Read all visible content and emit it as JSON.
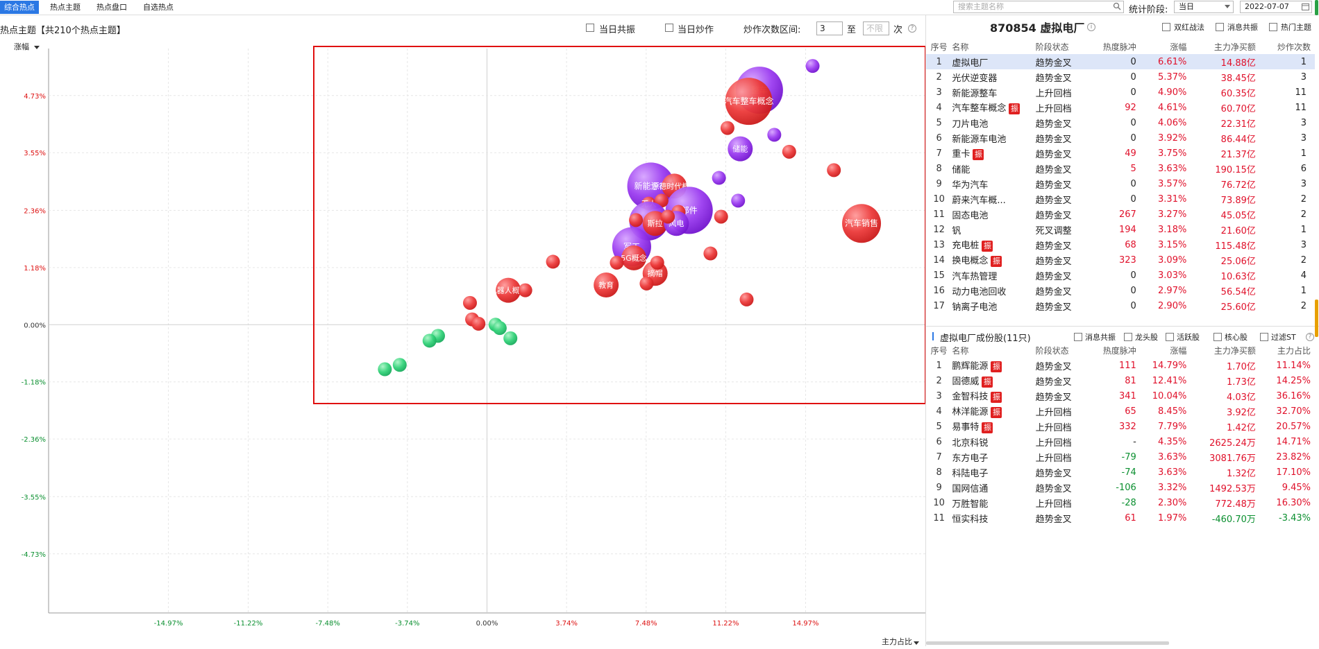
{
  "top_tabs": [
    "综合热点",
    "热点主题",
    "热点盘口",
    "自选热点"
  ],
  "search": {
    "placeholder": "搜索主题名称"
  },
  "stage_label": "统计阶段:",
  "stage_value": "当日",
  "date_value": "2022-07-07",
  "chart_header": {
    "title": "热点主题【共210个热点主题】",
    "cb_same_day_resonance": "当日共振",
    "cb_same_day_hype": "当日炒作",
    "hype_range_label": "炒作次数区间:",
    "hype_min": "3",
    "to": "至",
    "hype_max_placeholder": "不限",
    "times": "次"
  },
  "chart_data": {
    "type": "scatter",
    "ylabel": "涨幅",
    "xlabel": "主力占比",
    "xlim": [
      -20.6,
      20.6
    ],
    "ylim": [
      -5.95,
      5.7
    ],
    "x_ticks": [
      "-14.97%",
      "-11.22%",
      "-7.48%",
      "-3.74%",
      "0.00%",
      "3.74%",
      "7.48%",
      "11.22%",
      "14.97%"
    ],
    "x_tick_values": [
      -14.97,
      -11.22,
      -7.48,
      -3.74,
      0.0,
      3.74,
      7.48,
      11.22,
      14.97
    ],
    "y_ticks": [
      "4.73%",
      "3.55%",
      "2.36%",
      "1.18%",
      "0.00%",
      "-1.18%",
      "-2.36%",
      "-3.55%",
      "-4.73%"
    ],
    "y_tick_values": [
      4.73,
      3.55,
      2.36,
      1.18,
      0.0,
      -1.18,
      -2.36,
      -3.55,
      -4.73
    ],
    "colors": {
      "red": "#e8343a",
      "purple": "#9333ea",
      "green": "#2ecc71",
      "tick_red": "#d11",
      "tick_green": "#0a8f2f"
    },
    "points": [
      {
        "x": 12.8,
        "y": 4.84,
        "size": "xl",
        "color": "purple",
        "label": "整车"
      },
      {
        "x": 12.3,
        "y": 4.61,
        "size": "xl",
        "color": "red",
        "label": "汽车整车概念"
      },
      {
        "x": 15.3,
        "y": 5.34,
        "size": "s",
        "color": "purple",
        "label": ""
      },
      {
        "x": 11.3,
        "y": 4.06,
        "size": "s",
        "color": "red",
        "label": ""
      },
      {
        "x": 13.5,
        "y": 3.92,
        "size": "s",
        "color": "purple",
        "label": ""
      },
      {
        "x": 11.9,
        "y": 3.63,
        "size": "m",
        "color": "purple",
        "label": "储能"
      },
      {
        "x": 14.2,
        "y": 3.57,
        "size": "s",
        "color": "red",
        "label": ""
      },
      {
        "x": 16.3,
        "y": 3.19,
        "size": "s",
        "color": "red",
        "label": ""
      },
      {
        "x": 10.9,
        "y": 3.03,
        "size": "s",
        "color": "purple",
        "label": ""
      },
      {
        "x": 17.6,
        "y": 2.09,
        "size": "l",
        "color": "red",
        "label": "汽车销售"
      },
      {
        "x": 7.7,
        "y": 2.86,
        "size": "xl",
        "color": "purple",
        "label": "新能源车"
      },
      {
        "x": 8.8,
        "y": 2.86,
        "size": "m",
        "color": "red",
        "label": "宁德时代概念"
      },
      {
        "x": 9.5,
        "y": 2.36,
        "size": "xl",
        "color": "purple",
        "label": "部件"
      },
      {
        "x": 7.6,
        "y": 2.5,
        "size": "s",
        "color": "red",
        "label": "无人"
      },
      {
        "x": 8.2,
        "y": 2.56,
        "size": "s",
        "color": "red",
        "label": ""
      },
      {
        "x": 9.0,
        "y": 2.33,
        "size": "s",
        "color": "red",
        "label": ""
      },
      {
        "x": 7.6,
        "y": 2.14,
        "size": "l",
        "color": "purple",
        "label": ""
      },
      {
        "x": 7.9,
        "y": 2.09,
        "size": "m",
        "color": "red",
        "label": "斯拉"
      },
      {
        "x": 8.9,
        "y": 2.09,
        "size": "m",
        "color": "purple",
        "label": "风电"
      },
      {
        "x": 8.5,
        "y": 2.23,
        "size": "s",
        "color": "red",
        "label": ""
      },
      {
        "x": 7.0,
        "y": 2.16,
        "size": "s",
        "color": "red",
        "label": ""
      },
      {
        "x": 11.0,
        "y": 2.23,
        "size": "s",
        "color": "red",
        "label": ""
      },
      {
        "x": 11.8,
        "y": 2.56,
        "size": "s",
        "color": "purple",
        "label": ""
      },
      {
        "x": 6.8,
        "y": 1.61,
        "size": "l",
        "color": "purple",
        "label": "军工"
      },
      {
        "x": 6.9,
        "y": 1.38,
        "size": "m",
        "color": "red",
        "label": "5G概念"
      },
      {
        "x": 7.9,
        "y": 1.06,
        "size": "m",
        "color": "red",
        "label": "摘帽"
      },
      {
        "x": 8.0,
        "y": 1.28,
        "size": "s",
        "color": "red",
        "label": ""
      },
      {
        "x": 6.1,
        "y": 1.28,
        "size": "s",
        "color": "red",
        "label": ""
      },
      {
        "x": 7.5,
        "y": 0.85,
        "size": "s",
        "color": "red",
        "label": ""
      },
      {
        "x": 10.5,
        "y": 1.47,
        "size": "s",
        "color": "red",
        "label": ""
      },
      {
        "x": 5.6,
        "y": 0.82,
        "size": "m",
        "color": "red",
        "label": "教育"
      },
      {
        "x": 12.2,
        "y": 0.52,
        "size": "s",
        "color": "red",
        "label": ""
      },
      {
        "x": 3.1,
        "y": 1.3,
        "size": "s",
        "color": "red",
        "label": ""
      },
      {
        "x": 1.0,
        "y": 0.71,
        "size": "m",
        "color": "red",
        "label": "机器人概念"
      },
      {
        "x": 1.8,
        "y": 0.71,
        "size": "s",
        "color": "red",
        "label": ""
      },
      {
        "x": -0.8,
        "y": 0.45,
        "size": "s",
        "color": "red",
        "label": ""
      },
      {
        "x": -0.7,
        "y": 0.11,
        "size": "s",
        "color": "red",
        "label": ""
      },
      {
        "x": -0.4,
        "y": 0.02,
        "size": "s",
        "color": "red",
        "label": ""
      },
      {
        "x": 0.4,
        "y": 0.0,
        "size": "s",
        "color": "green",
        "label": ""
      },
      {
        "x": 0.6,
        "y": -0.07,
        "size": "s",
        "color": "green",
        "label": ""
      },
      {
        "x": 1.1,
        "y": -0.28,
        "size": "s",
        "color": "green",
        "label": ""
      },
      {
        "x": -2.3,
        "y": -0.23,
        "size": "s",
        "color": "green",
        "label": ""
      },
      {
        "x": -2.7,
        "y": -0.33,
        "size": "s",
        "color": "green",
        "label": ""
      },
      {
        "x": -4.1,
        "y": -0.83,
        "size": "s",
        "color": "green",
        "label": ""
      },
      {
        "x": -4.8,
        "y": -0.92,
        "size": "s",
        "color": "green",
        "label": ""
      }
    ]
  },
  "right_panel": {
    "header_code": "870854",
    "header_name": "虚拟电厂",
    "cb_double_red": "双红战法",
    "cb_news_resonance": "消息共振",
    "cb_hot_theme": "热门主题",
    "columns": [
      "序号",
      "名称",
      "阶段状态",
      "热度脉冲",
      "涨幅",
      "主力净买额",
      "炒作次数"
    ],
    "themes": [
      {
        "no": "1",
        "name": "虚拟电厂",
        "badge": "",
        "stage": "趋势金叉",
        "pulse": "0",
        "chg": "6.61%",
        "net": "14.88亿",
        "count": "1"
      },
      {
        "no": "2",
        "name": "光伏逆变器",
        "badge": "",
        "stage": "趋势金叉",
        "pulse": "0",
        "chg": "5.37%",
        "net": "38.45亿",
        "count": "3"
      },
      {
        "no": "3",
        "name": "新能源整车",
        "badge": "",
        "stage": "上升回档",
        "pulse": "0",
        "chg": "4.90%",
        "net": "60.35亿",
        "count": "11"
      },
      {
        "no": "4",
        "name": "汽车整车概念",
        "badge": "振",
        "stage": "上升回档",
        "pulse": "92",
        "chg": "4.61%",
        "net": "60.70亿",
        "count": "11"
      },
      {
        "no": "5",
        "name": "刀片电池",
        "badge": "",
        "stage": "趋势金叉",
        "pulse": "0",
        "chg": "4.06%",
        "net": "22.31亿",
        "count": "3"
      },
      {
        "no": "6",
        "name": "新能源车电池",
        "badge": "",
        "stage": "趋势金叉",
        "pulse": "0",
        "chg": "3.92%",
        "net": "86.44亿",
        "count": "3"
      },
      {
        "no": "7",
        "name": "重卡",
        "badge": "振",
        "stage": "趋势金叉",
        "pulse": "49",
        "chg": "3.75%",
        "net": "21.37亿",
        "count": "1"
      },
      {
        "no": "8",
        "name": "储能",
        "badge": "",
        "stage": "趋势金叉",
        "pulse": "5",
        "chg": "3.63%",
        "net": "190.15亿",
        "count": "6"
      },
      {
        "no": "9",
        "name": "华为汽车",
        "badge": "",
        "stage": "趋势金叉",
        "pulse": "0",
        "chg": "3.57%",
        "net": "76.72亿",
        "count": "3"
      },
      {
        "no": "10",
        "name": "蔚来汽车概...",
        "badge": "",
        "stage": "趋势金叉",
        "pulse": "0",
        "chg": "3.31%",
        "net": "73.89亿",
        "count": "2"
      },
      {
        "no": "11",
        "name": "固态电池",
        "badge": "",
        "stage": "趋势金叉",
        "pulse": "267",
        "chg": "3.27%",
        "net": "45.05亿",
        "count": "2"
      },
      {
        "no": "12",
        "name": "钒",
        "badge": "",
        "stage": "死叉调整",
        "pulse": "194",
        "chg": "3.18%",
        "net": "21.60亿",
        "count": "1"
      },
      {
        "no": "13",
        "name": "充电桩",
        "badge": "振",
        "stage": "趋势金叉",
        "pulse": "68",
        "chg": "3.15%",
        "net": "115.48亿",
        "count": "3"
      },
      {
        "no": "14",
        "name": "换电概念",
        "badge": "振",
        "stage": "趋势金叉",
        "pulse": "323",
        "chg": "3.09%",
        "net": "25.06亿",
        "count": "2"
      },
      {
        "no": "15",
        "name": "汽车热管理",
        "badge": "",
        "stage": "趋势金叉",
        "pulse": "0",
        "chg": "3.03%",
        "net": "10.63亿",
        "count": "4"
      },
      {
        "no": "16",
        "name": "动力电池回收",
        "badge": "",
        "stage": "趋势金叉",
        "pulse": "0",
        "chg": "2.97%",
        "net": "56.54亿",
        "count": "1"
      },
      {
        "no": "17",
        "name": "钠离子电池",
        "badge": "",
        "stage": "趋势金叉",
        "pulse": "0",
        "chg": "2.90%",
        "net": "25.60亿",
        "count": "2"
      }
    ],
    "stock_title": "虚拟电厂成份股(11只)",
    "cb_msg": "消息共振",
    "cb_dragon": "龙头股",
    "cb_active": "活跃股",
    "cb_core": "核心股",
    "cb_st": "过滤ST",
    "stock_columns": [
      "序号",
      "名称",
      "阶段状态",
      "热度脉冲",
      "涨幅",
      "主力净买额",
      "主力占比"
    ],
    "stocks": [
      {
        "no": "1",
        "name": "鹏辉能源",
        "badge": "振",
        "stage": "趋势金叉",
        "pulse": "111",
        "chg": "14.79%",
        "net": "1.70亿",
        "ratio": "11.14%"
      },
      {
        "no": "2",
        "name": "固德威",
        "badge": "振",
        "stage": "趋势金叉",
        "pulse": "81",
        "chg": "12.41%",
        "net": "1.73亿",
        "ratio": "14.25%"
      },
      {
        "no": "3",
        "name": "金智科技",
        "badge": "振",
        "stage": "趋势金叉",
        "pulse": "341",
        "chg": "10.04%",
        "net": "4.03亿",
        "ratio": "36.16%"
      },
      {
        "no": "4",
        "name": "林洋能源",
        "badge": "振",
        "stage": "上升回档",
        "pulse": "65",
        "chg": "8.45%",
        "net": "3.92亿",
        "ratio": "32.70%"
      },
      {
        "no": "5",
        "name": "易事特",
        "badge": "振",
        "stage": "上升回档",
        "pulse": "332",
        "chg": "7.79%",
        "net": "1.42亿",
        "ratio": "20.57%"
      },
      {
        "no": "6",
        "name": "北京科锐",
        "badge": "",
        "stage": "上升回档",
        "pulse": "-",
        "chg": "4.35%",
        "net": "2625.24万",
        "ratio": "14.71%"
      },
      {
        "no": "7",
        "name": "东方电子",
        "badge": "",
        "stage": "上升回档",
        "pulse": "-79",
        "chg": "3.63%",
        "net": "3081.76万",
        "ratio": "23.82%"
      },
      {
        "no": "8",
        "name": "科陆电子",
        "badge": "",
        "stage": "趋势金叉",
        "pulse": "-74",
        "chg": "3.63%",
        "net": "1.32亿",
        "ratio": "17.10%"
      },
      {
        "no": "9",
        "name": "国网信通",
        "badge": "",
        "stage": "趋势金叉",
        "pulse": "-106",
        "chg": "3.32%",
        "net": "1492.53万",
        "ratio": "9.45%"
      },
      {
        "no": "10",
        "name": "万胜智能",
        "badge": "",
        "stage": "上升回档",
        "pulse": "-28",
        "chg": "2.30%",
        "net": "772.48万",
        "ratio": "16.30%"
      },
      {
        "no": "11",
        "name": "恒实科技",
        "badge": "",
        "stage": "趋势金叉",
        "pulse": "61",
        "chg": "1.97%",
        "net": "-460.70万",
        "ratio": "-3.43%"
      }
    ]
  }
}
